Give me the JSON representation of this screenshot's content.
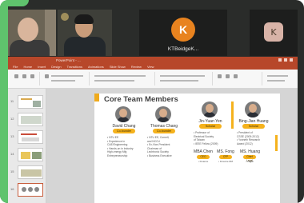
{
  "participants": [
    {
      "type": "camera",
      "label": "participant-video-1"
    },
    {
      "type": "camera",
      "label": "participant-video-2"
    },
    {
      "type": "avatar",
      "initial": "K",
      "name": "KTBeidgeK...",
      "color": "#e8831f"
    },
    {
      "type": "avatar",
      "initial": "K",
      "name": "",
      "color": "#d8b3a7"
    }
  ],
  "app": {
    "title": "PowerPoint - ...",
    "menu": [
      "File",
      "Home",
      "Insert",
      "Design",
      "Transitions",
      "Animations",
      "Slide Show",
      "Review",
      "View"
    ]
  },
  "thumbnails": [
    {
      "num": "11"
    },
    {
      "num": "12"
    },
    {
      "num": "13"
    },
    {
      "num": "14"
    },
    {
      "num": "15"
    },
    {
      "num": "16"
    }
  ],
  "slide": {
    "title": "Core Team Members",
    "members": [
      {
        "name": "David Chang",
        "role": "Co-founder",
        "bullets": [
          "• NTU EE",
          "• Experience in",
          "  CAE/Engineering",
          "• Hands-on in Industry",
          "  High-energy Mfg",
          "  Entrepreneurship"
        ]
      },
      {
        "name": "Thomas Chang",
        "role": "Co-founder",
        "bullets": [
          "• NTU EE, Cornell,",
          "  and NCCU",
          "• Ex-Vice-President",
          "  Chairman of",
          "  Lechtronic Society",
          "• Business Executive"
        ]
      },
      {
        "name": "Jin-Yuan Yen",
        "role": "Scholar",
        "bullets": [
          "• Professor of",
          "  Electrical Society",
          "  of Taiwan",
          "• IEEE Fellow (2009)"
        ]
      },
      {
        "name": "Bing-Jian Huang",
        "role": "Scholar",
        "bullets": [
          "• President of",
          "  CSSE (2009-2012)",
          "• Yonneth Research",
          "  Award (2012)"
        ]
      }
    ],
    "small_members": [
      {
        "name": "MBA Chen",
        "role": "CEO",
        "bullet": "• Finance"
      },
      {
        "name": "MS. Fong",
        "role": "CFP",
        "bullet": "• Finance RM"
      },
      {
        "name": "MS. Huang",
        "role": "Chief Legal",
        "bullet": "• Legal"
      }
    ]
  }
}
